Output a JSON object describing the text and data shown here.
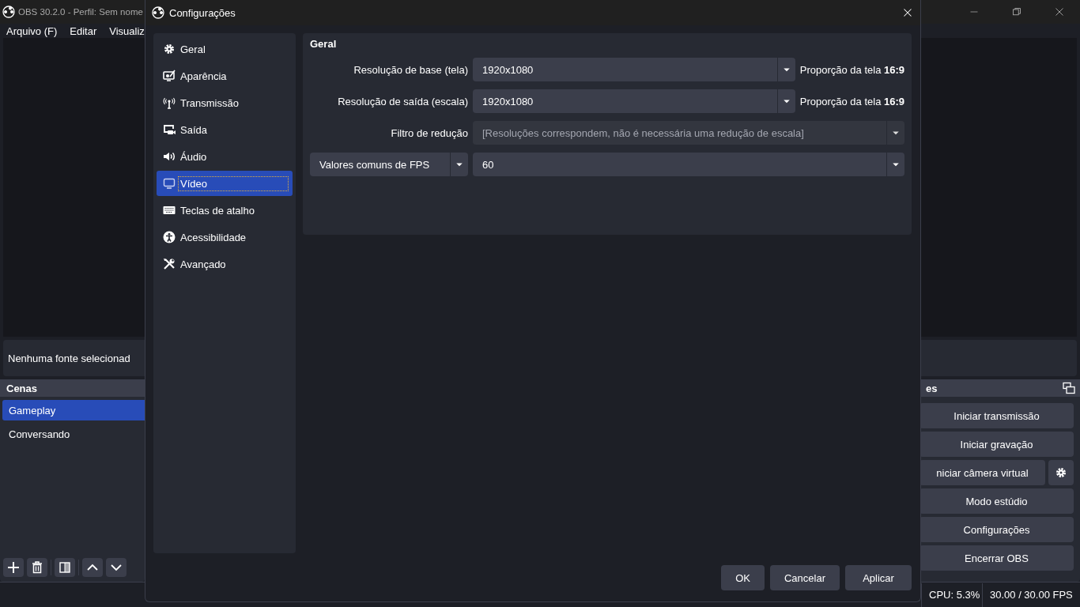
{
  "main_window": {
    "title": "OBS 30.2.0 - Perfil: Sem nome",
    "menu": [
      "Arquivo (F)",
      "Editar",
      "Visualiz"
    ],
    "source_bar": "Nenhuma fonte selecionad",
    "scenes": {
      "title": "Cenas",
      "items": [
        {
          "label": "Gameplay",
          "selected": true
        },
        {
          "label": "Conversando",
          "selected": false
        }
      ]
    },
    "controls": {
      "title": "es",
      "buttons": [
        {
          "label": "Iniciar transmissão",
          "kind": "plain"
        },
        {
          "label": "Iniciar gravação",
          "kind": "plain"
        },
        {
          "label": "niciar câmera virtual",
          "kind": "with-settings"
        },
        {
          "label": "Modo estúdio",
          "kind": "plain"
        },
        {
          "label": "Configurações",
          "kind": "plain"
        },
        {
          "label": "Encerrar OBS",
          "kind": "plain"
        }
      ]
    },
    "status_bar": [
      "CPU: 5.3%",
      "30.00 / 30.00 FPS"
    ]
  },
  "dialog": {
    "title": "Configurações",
    "sidebar": [
      {
        "label": "Geral",
        "kind": "gear",
        "selected": false
      },
      {
        "label": "Aparência",
        "kind": "appearance",
        "selected": false
      },
      {
        "label": "Transmissão",
        "kind": "antenna",
        "selected": false
      },
      {
        "label": "Saída",
        "kind": "output",
        "selected": false
      },
      {
        "label": "Áudio",
        "kind": "speaker",
        "selected": false
      },
      {
        "label": "Vídeo",
        "kind": "monitor",
        "selected": true
      },
      {
        "label": "Teclas de atalho",
        "kind": "keyboard",
        "selected": false
      },
      {
        "label": "Acessibilidade",
        "kind": "accessibility",
        "selected": false
      },
      {
        "label": "Avançado",
        "kind": "tools",
        "selected": false
      }
    ],
    "section": {
      "title": "Geral",
      "rows": [
        {
          "kind": "labelled",
          "label": "Resolução de base (tela)",
          "value": "1920x1080",
          "note": "Proporção da tela **16:9**",
          "disabled": false
        },
        {
          "kind": "labelled",
          "label": "Resolução de saída (escala)",
          "value": "1920x1080",
          "note": "Proporção da tela **16:9**",
          "disabled": false
        },
        {
          "kind": "labelled",
          "label": "Filtro de redução",
          "value": "[Resoluções correspondem, não é necessária uma redução de escala]",
          "disabled": true
        },
        {
          "kind": "dropdown-label",
          "label": "Valores comuns de FPS",
          "value": "60",
          "disabled": false
        }
      ]
    },
    "buttons": [
      "OK",
      "Cancelar",
      "Aplicar"
    ]
  }
}
